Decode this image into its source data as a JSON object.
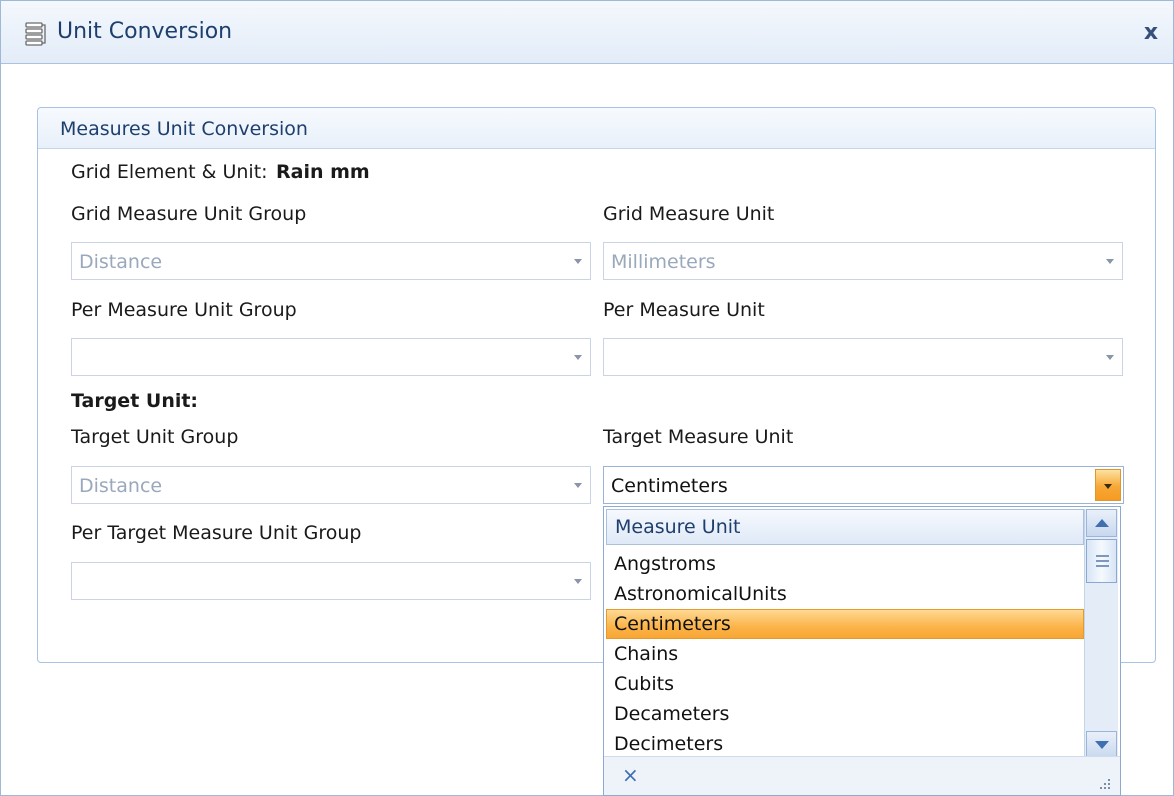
{
  "window": {
    "title": "Unit Conversion",
    "close_label": "x",
    "icon": "conversion-icon"
  },
  "group": {
    "header": "Measures Unit Conversion",
    "grid_element_label": "Grid Element & Unit:",
    "grid_element_value": "Rain mm"
  },
  "fields": {
    "grid_group": {
      "label": "Grid Measure Unit Group",
      "value": "Distance"
    },
    "grid_unit": {
      "label": "Grid Measure Unit",
      "value": "Millimeters"
    },
    "per_group": {
      "label": "Per Measure Unit Group",
      "value": ""
    },
    "per_unit": {
      "label": "Per Measure Unit",
      "value": ""
    },
    "target_heading": "Target Unit:",
    "target_group": {
      "label": "Target Unit Group",
      "value": "Distance"
    },
    "target_unit": {
      "label": "Target Measure Unit",
      "value": "Centimeters"
    },
    "per_target_group": {
      "label": "Per Target Measure Unit Group",
      "value": ""
    }
  },
  "dropdown": {
    "header": "Measure Unit",
    "items": [
      "Angstroms",
      "AstronomicalUnits",
      "Centimeters",
      "Chains",
      "Cubits",
      "Decameters",
      "Decimeters"
    ],
    "selected": "Centimeters",
    "clear_label": "×"
  },
  "colors": {
    "accent_title": "#1e3f6e",
    "selection": "#fbb44a",
    "border": "#a8c2e2"
  }
}
